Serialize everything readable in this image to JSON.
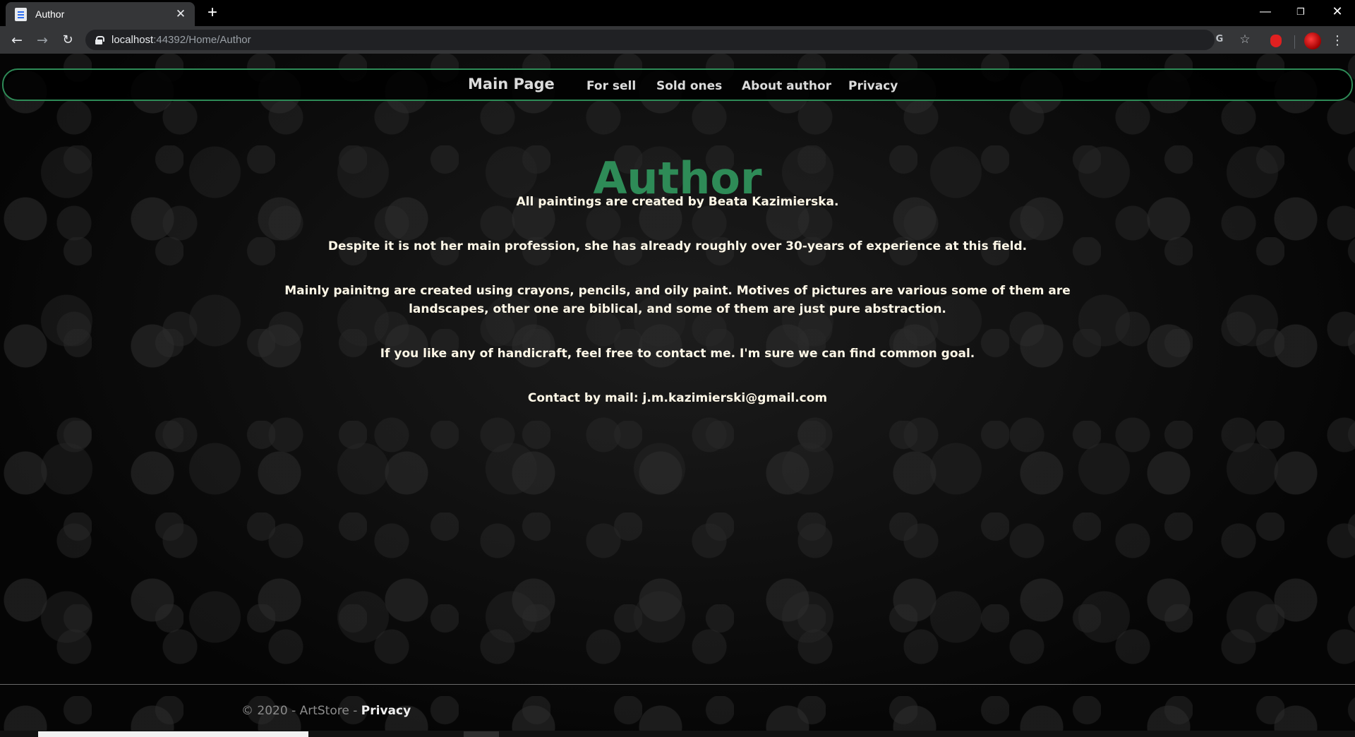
{
  "browser": {
    "tab_title": "Author",
    "tab_close": "✕",
    "new_tab": "+",
    "window_minimize": "—",
    "window_restore": "❐",
    "window_close": "✕",
    "url_host": "localhost",
    "url_rest": ":44392/Home/Author",
    "nav_back": "←",
    "nav_forward": "→",
    "nav_reload": "↻",
    "translate_label": "G",
    "star": "☆",
    "menu": "⋮"
  },
  "navbar": {
    "brand": "Main Page",
    "links": [
      "For sell",
      "Sold ones",
      "About author",
      "Privacy"
    ]
  },
  "main": {
    "heading": "Author",
    "paragraphs": [
      "All paintings are created by Beata Kazimierska.",
      "Despite it is not her main profession, she has already roughly over 30-years of experience at this field.",
      "Mainly painitng are created using crayons, pencils, and oily paint. Motives of pictures are various some of them are landscapes, other one are biblical, and some of them are just pure abstraction.",
      "If you like any of handicraft, feel free to contact me. I'm sure we can find common goal.",
      "Contact by mail: j.m.kazimierski@gmail.com"
    ]
  },
  "footer": {
    "copyright": "© 2020 - ArtStore - ",
    "privacy_link": "Privacy"
  },
  "colors": {
    "accent_green": "#2e8b57",
    "text_cream": "#fff8e7",
    "background": "#0c0c0c"
  }
}
